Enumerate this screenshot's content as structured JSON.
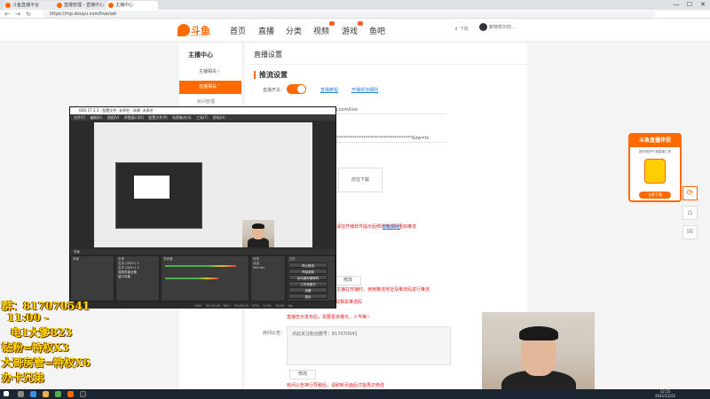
{
  "browser": {
    "tabs": [
      "斗鱼直播平台",
      "直播管理 - 直播中心",
      "主播中心"
    ],
    "url": "https://mp.douyu.com/live/set",
    "controls": {
      "back": "←",
      "forward": "→",
      "reload": "↻",
      "minimize": "—",
      "maximize": "☐",
      "close": "✕"
    }
  },
  "site": {
    "logo": "斗鱼",
    "logo_sub": "DOUYU.COM",
    "nav": [
      "首页",
      "直播",
      "分类",
      "视频",
      "游戏",
      "鱼吧"
    ],
    "download": "下载",
    "user": "斯特凯尔的..."
  },
  "sidebar": {
    "title": "主播中心",
    "items": [
      "主播相关",
      "直播相关"
    ],
    "sub_items": [
      "房间管理"
    ]
  },
  "main": {
    "page_title": "直播设置",
    "section_title": "推流设置",
    "toggle_label": "直播开关：",
    "links": [
      "直播教程",
      "开播规范细则"
    ],
    "rtmp_url": "rtmp://sendtc3a.douyu.com/live",
    "stream_code": "...onid=1&secret=**************************************&tw=fs",
    "copy_button": "复制",
    "reset_button": "重置",
    "record_button": "前往下载",
    "warnings": [
      "请在开播软件提示后修改推流码重启推流",
      "请主播在开播时，使用推流地址及推流码进行推流",
      "修改推流码后，请重新获取相关推流码",
      "请主播在开播软件里修改推流",
      "直播告示发布后，需要更多曝光，人气等~",
      "房间公告换行导致后，请刷新页面后才能再次修改"
    ],
    "follow_link": "粉丝助手",
    "notice_label": "房间公告：",
    "notice_text": "点此关注粉丝群号：817070541",
    "modify_button": "修改",
    "modify_button_2": "修改"
  },
  "promo": {
    "header": "斗鱼直播伴侣",
    "desc": "超好用的PC端直播工具",
    "button": "立即下载"
  },
  "side_buttons": [
    "⟳",
    "⌂",
    "✉"
  ],
  "obs": {
    "title": "OBS 27.1.3 - 配置文件: 未命名 - 场景: 未命名",
    "menu": "文件(F) 编辑(E) 视图(V) 停靠窗口(D) 配置文件(P) 场景集合(S) 工具(T) 帮助(H)",
    "panels": [
      "场景",
      "来源",
      "混音器",
      "转场",
      "控件"
    ],
    "sources": [
      "文字 (GDI+) 2",
      "文字 (GDI+) 3",
      "视频采集设备",
      "窗口采集"
    ],
    "buttons": [
      "停止推流",
      "开始录制",
      "启动虚拟摄像机",
      "工作室模式",
      "设置",
      "退出"
    ],
    "status": "LIVE: 00:02:18 REC: 00:00:00 CPU: 2.5%, 30.00 fps",
    "transition": "淡出",
    "duration": "300 ms"
  },
  "overlay": {
    "line1": "群：817070541",
    "line2": "11:00 -",
    "line3": "电1大爹823",
    "line4": "钻粉=特权X3",
    "line5": "大哥房管=特权X6",
    "line6": "办卡兄弟"
  },
  "taskbar": {
    "time": "12:55",
    "date": "2021/12/22"
  },
  "colors": {
    "accent": "#ff6a00",
    "link": "#2b7fe0",
    "warning": "#e02020",
    "overlay": "#ffd800"
  }
}
